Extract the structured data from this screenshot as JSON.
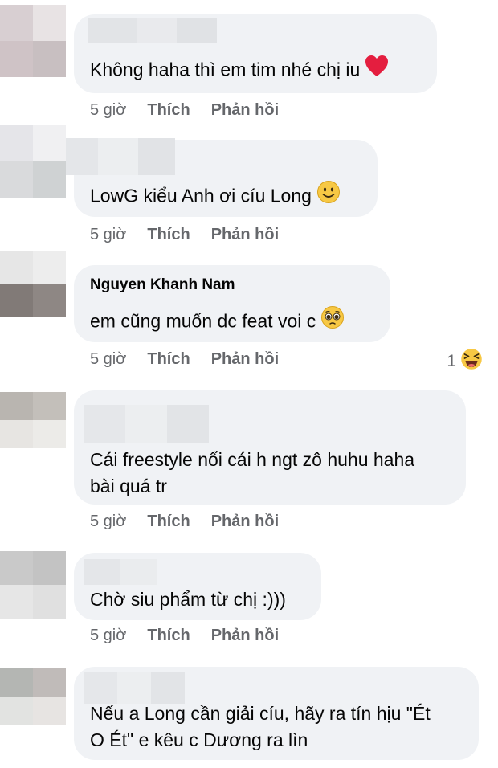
{
  "comments": [
    {
      "author": "",
      "text": [
        "Không haha thì em tim nhé chị iu"
      ],
      "emoji": "heart",
      "time": "5 giờ",
      "like_label": "Thích",
      "reply_label": "Phản hồi"
    },
    {
      "author": "",
      "text": [
        "LowG kiểu Anh ơi cíu Long"
      ],
      "emoji": "slight-smile",
      "time": "5 giờ",
      "like_label": "Thích",
      "reply_label": "Phản hồi"
    },
    {
      "author": "Nguyen Khanh Nam",
      "text": [
        "em cũng muốn dc feat voi c"
      ],
      "emoji": "pleading-face",
      "time": "5 giờ",
      "like_label": "Thích",
      "reply_label": "Phản hồi",
      "reaction_count": "1",
      "reaction_icon": "laughing-face-icon"
    },
    {
      "author": "",
      "text": [
        "Cái freestyle nổi cái h ngt zô huhu haha",
        "bài quá tr"
      ],
      "time": "5 giờ",
      "like_label": "Thích",
      "reply_label": "Phản hồi"
    },
    {
      "author": "",
      "text": [
        "Chờ siu phẩm từ chị :)))"
      ],
      "time": "5 giờ",
      "like_label": "Thích",
      "reply_label": "Phản hồi"
    },
    {
      "author": "",
      "text": [
        "Nếu a Long cần giải cíu, hãy ra tín hịu \"Ét",
        "O Ét\" e kêu c Dương ra lìn"
      ]
    }
  ],
  "colors": {
    "bubble": "#f0f2f5",
    "meta": "#65676b",
    "text": "#050505",
    "heart": "#e41e3f",
    "emoji_yellow": "#f7c844"
  }
}
